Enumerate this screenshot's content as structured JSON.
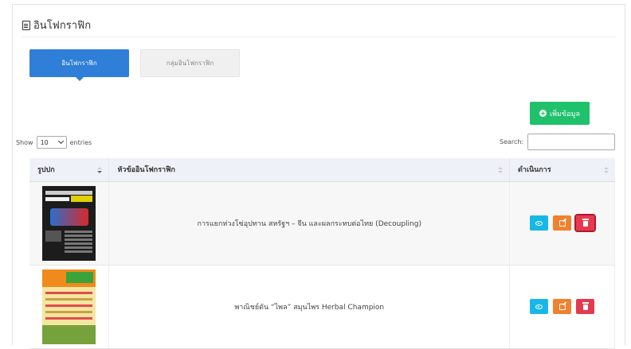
{
  "page": {
    "title": "อินโฟกราฟิก"
  },
  "tabs": [
    {
      "label": "อินโฟกราฟิก",
      "active": true
    },
    {
      "label": "กลุ่มอินโฟกราฟิก",
      "active": false
    }
  ],
  "toolbar": {
    "add_label": "เพิ่มข้อมูล"
  },
  "length_menu": {
    "prefix": "Show",
    "value": "10",
    "suffix": "entries"
  },
  "search": {
    "label": "Search:",
    "value": ""
  },
  "table": {
    "headers": [
      "รูปปก",
      "หัวข้ออินโฟกราฟิก",
      "ดำเนินการ"
    ],
    "rows": [
      {
        "title": "การแยกห่วงโซ่อุปทาน สหรัฐฯ – จีน และผลกระทบต่อไทย (Decoupling)"
      },
      {
        "title": "พาณิชย์ดัน “ไพล” สมุนไพร Herbal Champion"
      }
    ]
  },
  "colors": {
    "primary": "#2f7fd8",
    "success": "#1fc16b",
    "info": "#19b7e8",
    "warning": "#f0812f",
    "danger": "#e63950"
  },
  "icons": {
    "title": "document-icon",
    "add": "plus-circle-icon",
    "view": "eye-icon",
    "edit": "edit-icon",
    "delete": "trash-icon"
  }
}
